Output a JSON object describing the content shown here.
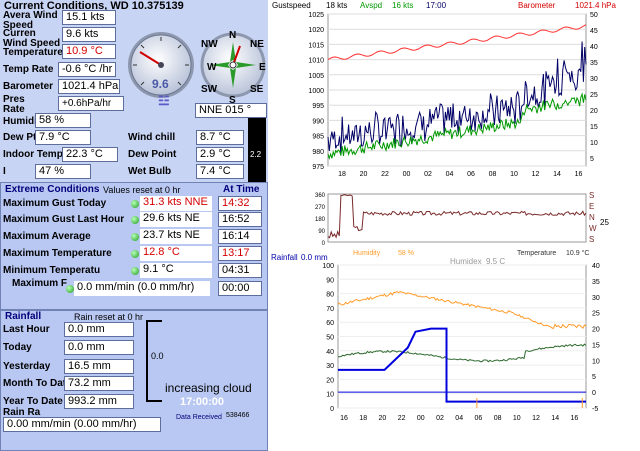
{
  "header": {
    "title": "Current Conditions, WD 10.375139"
  },
  "current": {
    "wind_speed_label": "Avera Wind Speed",
    "wind_speed": "15.1 kts",
    "current_wind_label": "Curren Wind Speed",
    "current_wind": "9.6 kts",
    "temperature_label": "Temperature",
    "temperature": "10.9 °C",
    "temp_rate_label": "Temp Rate",
    "temp_rate": "-0.6 °C /hr",
    "barometer_label": "Barometer",
    "barometer": "1021.4 hPa",
    "pres_rate_label": "Pres Rate",
    "pres_rate": "+0.6hPa/hr",
    "humidity_label": "Humidit",
    "humidity": "58 %",
    "dewpt_depr_label": "Dew Pt Depr",
    "dewpt_depr": "7.9 °C",
    "indoor_temp_label": "Indoor Temp",
    "indoor_temp": "22.3 °C",
    "indoor_hum_label": "I",
    "indoor_hum": "47 %",
    "wind_chill_label": "Wind chill",
    "wind_chill": "8.7 °C",
    "dew_point_label": "Dew Point",
    "dew_point": "2.9 °C",
    "wet_bulb_label": "Wet Bulb",
    "wet_bulb": "7.4 °C",
    "gauge_value": "9.6",
    "direction": "NNE  015 °",
    "uv_value": "2.2",
    "compass": {
      "n": "N",
      "ne": "NE",
      "e": "E",
      "se": "SE",
      "s": "S",
      "sw": "SW",
      "w": "W",
      "nw": "NW"
    }
  },
  "extreme": {
    "title": "Extreme Conditions",
    "subtitle": "Values reset at 0 hr",
    "at_time_label": "At Time",
    "rows": [
      {
        "label": "Maximum Gust Today",
        "value": "31.3 kts NNE",
        "time": "14:32",
        "red": true
      },
      {
        "label": "Maximum Gust Last Hour",
        "value": "29.6 kts  NE",
        "time": "16:52",
        "red": false
      },
      {
        "label": "Maximum Average",
        "value": "23.7 kts  NE",
        "time": "16:14",
        "red": false
      },
      {
        "label": "Maximum Temperature",
        "value": "12.8 °C",
        "time": "13:17",
        "red": true
      },
      {
        "label": "Minimum Temperatu",
        "value": "9.1 °C",
        "time": "04:31",
        "red": false
      },
      {
        "label": "Maximum F",
        "value": "0.0 mm/min (0.0 mm/hr)",
        "time": "00:00",
        "red": false
      }
    ]
  },
  "rainfall": {
    "title": "Rainfall",
    "subtitle": "Rain reset at 0 hr",
    "rows": [
      {
        "label": "Last Hour",
        "value": "0.0 mm"
      },
      {
        "label": "Today",
        "value": "0.0 mm"
      },
      {
        "label": "Yesterday",
        "value": "16.5 mm"
      },
      {
        "label": "Month To Dat",
        "value": "73.2 mm"
      },
      {
        "label": "Year To Date",
        "value": "993.2 mm"
      }
    ],
    "rate_label": "Rain Ra",
    "rate": "0.00 mm/min (0.00 mm/hr)",
    "bar_value": "0.0"
  },
  "forecast": {
    "text": "increasing cloud",
    "time": "17:00:00",
    "data_received_label": "Data Received",
    "data_received": "538466"
  },
  "graph_top": {
    "legend": {
      "gust_label": "Gustspeed",
      "gust_value": "18 kts",
      "avg_label": "Avspd",
      "avg_value": "16 kts",
      "time": "17:00",
      "baro_label": "Barometer",
      "baro_value": "1021.4 hPa"
    },
    "left_ticks": [
      "1025",
      "1020",
      "1015",
      "1010",
      "1005",
      "1000",
      "995",
      "990",
      "985",
      "980",
      "975"
    ],
    "right_ticks": [
      "50",
      "45",
      "40",
      "35",
      "30",
      "25",
      "20",
      "15",
      "10",
      "5"
    ],
    "x_ticks": [
      "18",
      "20",
      "22",
      "00",
      "02",
      "04",
      "06",
      "08",
      "10",
      "12",
      "14",
      "16"
    ]
  },
  "graph_dir": {
    "left_ticks": [
      "360",
      "270",
      "180",
      "90",
      "0"
    ],
    "right_letters": [
      "S",
      "E",
      "N",
      "W",
      "S"
    ],
    "right_value": "25"
  },
  "graph_bottom": {
    "labels": {
      "rainfall_label": "Rainfall",
      "rainfall_value": "0.0 mm",
      "humidity_label": "Humidity",
      "humidity_value": "58 %",
      "humidex_label": "Humidex",
      "humidex_value": "9.5 C",
      "temp_label": "Temperature",
      "temp_value": "10.9 °C"
    },
    "left_ticks": [
      "100",
      "90",
      "80",
      "70",
      "60",
      "50",
      "40",
      "30",
      "20",
      "10",
      "0"
    ],
    "right_ticks": [
      "40",
      "35",
      "30",
      "25",
      "20",
      "15",
      "10",
      "5",
      "0",
      "-5"
    ],
    "x_ticks": [
      "16",
      "18",
      "20",
      "22",
      "00",
      "02",
      "04",
      "06",
      "08",
      "10",
      "12",
      "14",
      "16"
    ]
  },
  "colors": {
    "background": "#c8d4f4",
    "panel": "#b9c8f2",
    "header_text": "#00007a",
    "alert": "#d40000",
    "barometer": "#ff3030",
    "gust": "#000066",
    "average": "#009900",
    "temperature": "#ff9c2a",
    "humidity": "#2e6a2e",
    "rainfall": "#0000dd",
    "direction": "#7a2a2a"
  }
}
